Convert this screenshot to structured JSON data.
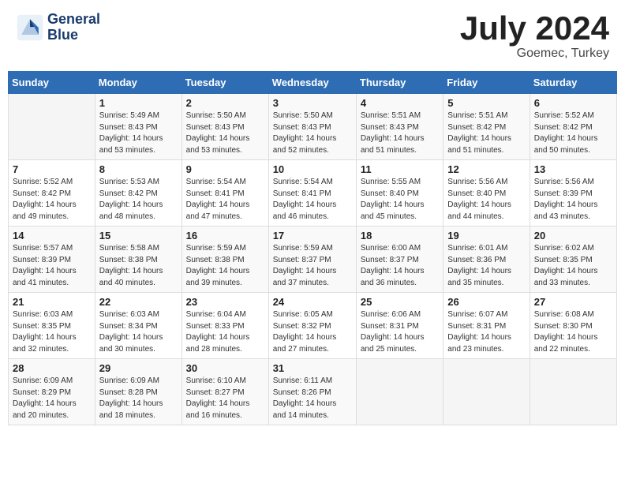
{
  "logo": {
    "line1": "General",
    "line2": "Blue"
  },
  "title": "July 2024",
  "subtitle": "Goemec, Turkey",
  "weekdays": [
    "Sunday",
    "Monday",
    "Tuesday",
    "Wednesday",
    "Thursday",
    "Friday",
    "Saturday"
  ],
  "weeks": [
    [
      {
        "day": "",
        "info": ""
      },
      {
        "day": "1",
        "info": "Sunrise: 5:49 AM\nSunset: 8:43 PM\nDaylight: 14 hours\nand 53 minutes."
      },
      {
        "day": "2",
        "info": "Sunrise: 5:50 AM\nSunset: 8:43 PM\nDaylight: 14 hours\nand 53 minutes."
      },
      {
        "day": "3",
        "info": "Sunrise: 5:50 AM\nSunset: 8:43 PM\nDaylight: 14 hours\nand 52 minutes."
      },
      {
        "day": "4",
        "info": "Sunrise: 5:51 AM\nSunset: 8:43 PM\nDaylight: 14 hours\nand 51 minutes."
      },
      {
        "day": "5",
        "info": "Sunrise: 5:51 AM\nSunset: 8:42 PM\nDaylight: 14 hours\nand 51 minutes."
      },
      {
        "day": "6",
        "info": "Sunrise: 5:52 AM\nSunset: 8:42 PM\nDaylight: 14 hours\nand 50 minutes."
      }
    ],
    [
      {
        "day": "7",
        "info": "Sunrise: 5:52 AM\nSunset: 8:42 PM\nDaylight: 14 hours\nand 49 minutes."
      },
      {
        "day": "8",
        "info": "Sunrise: 5:53 AM\nSunset: 8:42 PM\nDaylight: 14 hours\nand 48 minutes."
      },
      {
        "day": "9",
        "info": "Sunrise: 5:54 AM\nSunset: 8:41 PM\nDaylight: 14 hours\nand 47 minutes."
      },
      {
        "day": "10",
        "info": "Sunrise: 5:54 AM\nSunset: 8:41 PM\nDaylight: 14 hours\nand 46 minutes."
      },
      {
        "day": "11",
        "info": "Sunrise: 5:55 AM\nSunset: 8:40 PM\nDaylight: 14 hours\nand 45 minutes."
      },
      {
        "day": "12",
        "info": "Sunrise: 5:56 AM\nSunset: 8:40 PM\nDaylight: 14 hours\nand 44 minutes."
      },
      {
        "day": "13",
        "info": "Sunrise: 5:56 AM\nSunset: 8:39 PM\nDaylight: 14 hours\nand 43 minutes."
      }
    ],
    [
      {
        "day": "14",
        "info": "Sunrise: 5:57 AM\nSunset: 8:39 PM\nDaylight: 14 hours\nand 41 minutes."
      },
      {
        "day": "15",
        "info": "Sunrise: 5:58 AM\nSunset: 8:38 PM\nDaylight: 14 hours\nand 40 minutes."
      },
      {
        "day": "16",
        "info": "Sunrise: 5:59 AM\nSunset: 8:38 PM\nDaylight: 14 hours\nand 39 minutes."
      },
      {
        "day": "17",
        "info": "Sunrise: 5:59 AM\nSunset: 8:37 PM\nDaylight: 14 hours\nand 37 minutes."
      },
      {
        "day": "18",
        "info": "Sunrise: 6:00 AM\nSunset: 8:37 PM\nDaylight: 14 hours\nand 36 minutes."
      },
      {
        "day": "19",
        "info": "Sunrise: 6:01 AM\nSunset: 8:36 PM\nDaylight: 14 hours\nand 35 minutes."
      },
      {
        "day": "20",
        "info": "Sunrise: 6:02 AM\nSunset: 8:35 PM\nDaylight: 14 hours\nand 33 minutes."
      }
    ],
    [
      {
        "day": "21",
        "info": "Sunrise: 6:03 AM\nSunset: 8:35 PM\nDaylight: 14 hours\nand 32 minutes."
      },
      {
        "day": "22",
        "info": "Sunrise: 6:03 AM\nSunset: 8:34 PM\nDaylight: 14 hours\nand 30 minutes."
      },
      {
        "day": "23",
        "info": "Sunrise: 6:04 AM\nSunset: 8:33 PM\nDaylight: 14 hours\nand 28 minutes."
      },
      {
        "day": "24",
        "info": "Sunrise: 6:05 AM\nSunset: 8:32 PM\nDaylight: 14 hours\nand 27 minutes."
      },
      {
        "day": "25",
        "info": "Sunrise: 6:06 AM\nSunset: 8:31 PM\nDaylight: 14 hours\nand 25 minutes."
      },
      {
        "day": "26",
        "info": "Sunrise: 6:07 AM\nSunset: 8:31 PM\nDaylight: 14 hours\nand 23 minutes."
      },
      {
        "day": "27",
        "info": "Sunrise: 6:08 AM\nSunset: 8:30 PM\nDaylight: 14 hours\nand 22 minutes."
      }
    ],
    [
      {
        "day": "28",
        "info": "Sunrise: 6:09 AM\nSunset: 8:29 PM\nDaylight: 14 hours\nand 20 minutes."
      },
      {
        "day": "29",
        "info": "Sunrise: 6:09 AM\nSunset: 8:28 PM\nDaylight: 14 hours\nand 18 minutes."
      },
      {
        "day": "30",
        "info": "Sunrise: 6:10 AM\nSunset: 8:27 PM\nDaylight: 14 hours\nand 16 minutes."
      },
      {
        "day": "31",
        "info": "Sunrise: 6:11 AM\nSunset: 8:26 PM\nDaylight: 14 hours\nand 14 minutes."
      },
      {
        "day": "",
        "info": ""
      },
      {
        "day": "",
        "info": ""
      },
      {
        "day": "",
        "info": ""
      }
    ]
  ]
}
